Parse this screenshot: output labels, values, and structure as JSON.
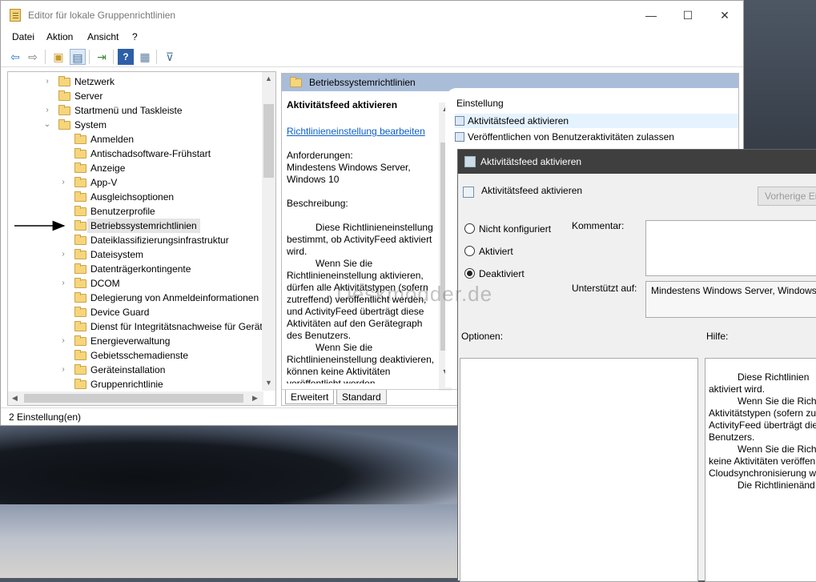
{
  "window": {
    "title": "Editor für lokale Gruppenrichtlinien",
    "minimize": "—",
    "maximize": "☐",
    "close": "✕"
  },
  "menu": [
    "Datei",
    "Aktion",
    "Ansicht",
    "?"
  ],
  "toolbar": {
    "back": "⇦",
    "forward": "⇨",
    "up": "▣",
    "show_hide": "▤",
    "export": "⇥",
    "help": "?",
    "properties": "▦",
    "filter": "⊽"
  },
  "tree": {
    "items": [
      {
        "label": "Netzwerk",
        "expander": "›"
      },
      {
        "label": "Server",
        "expander": ""
      },
      {
        "label": "Startmenü und Taskleiste",
        "expander": "›"
      },
      {
        "label": "System",
        "expander": "⌄"
      },
      {
        "label": "Anmelden",
        "expander": ""
      },
      {
        "label": "Antischadsoftware-Frühstart",
        "expander": ""
      },
      {
        "label": "Anzeige",
        "expander": ""
      },
      {
        "label": "App-V",
        "expander": "›"
      },
      {
        "label": "Ausgleichsoptionen",
        "expander": ""
      },
      {
        "label": "Benutzerprofile",
        "expander": ""
      },
      {
        "label": "Betriebssystemrichtlinien",
        "expander": ""
      },
      {
        "label": "Dateiklassifizierungsinfrastruktur",
        "expander": ""
      },
      {
        "label": "Dateisystem",
        "expander": "›"
      },
      {
        "label": "Datenträgerkontingente",
        "expander": ""
      },
      {
        "label": "DCOM",
        "expander": "›"
      },
      {
        "label": "Delegierung von Anmeldeinformationen",
        "expander": ""
      },
      {
        "label": "Device Guard",
        "expander": ""
      },
      {
        "label": "Dienst für Integritätsnachweise für Geräte",
        "expander": ""
      },
      {
        "label": "Energieverwaltung",
        "expander": "›"
      },
      {
        "label": "Gebietsschemadienste",
        "expander": ""
      },
      {
        "label": "Geräteinstallation",
        "expander": "›"
      },
      {
        "label": "Gruppenrichtlinie",
        "expander": ""
      }
    ]
  },
  "middle": {
    "header": "Betriebssystemrichtlinien",
    "policy_title": "Aktivitätsfeed aktivieren",
    "edit_link": "Richtlinieneinstellung bearbeiten",
    "requirements_label": "Anforderungen:",
    "requirements_value": "Mindestens Windows Server, Windows 10",
    "description_label": "Beschreibung:",
    "description_1": "Diese Richtlinieneinstellung bestimmt, ob ActivityFeed aktiviert wird.",
    "description_2": "Wenn Sie die Richtlinieneinstellung aktivieren, dürfen alle Aktivitätstypen (sofern zutreffend) veröffentlicht werden, und ActivityFeed überträgt diese Aktivitäten auf den Gerätegraph des Benutzers.",
    "description_3": "Wenn Sie die Richtlinieneinstellung deaktivieren, können keine Aktivitäten veröffentlicht werden,",
    "list_header": "Einstellung",
    "rows": [
      "Aktivitätsfeed aktivieren",
      "Veröffentlichen von Benutzeraktivitäten zulassen"
    ],
    "tabs": [
      "Erweitert",
      "Standard"
    ]
  },
  "status": "2 Einstellung(en)",
  "dialog": {
    "title": "Aktivitätsfeed aktivieren",
    "subtitle": "Aktivitätsfeed aktivieren",
    "prev_button": "Vorherige Einstellung",
    "radio_not_configured": "Nicht konfiguriert",
    "radio_enabled": "Aktiviert",
    "radio_disabled": "Deaktiviert",
    "selected": "Deaktiviert",
    "comment_label": "Kommentar:",
    "supported_label": "Unterstützt auf:",
    "supported_value": "Mindestens Windows Server, Windows",
    "options_label": "Optionen:",
    "help_label": "Hilfe:",
    "help_lines": [
      "Diese Richtlinien",
      "aktiviert wird.",
      "Wenn Sie die Richt",
      "Aktivitätstypen (sofern zu",
      "ActivityFeed überträgt die",
      "Benutzers.",
      "Wenn Sie die Richt",
      "keine Aktivitäten veröffen",
      "Cloudsynchronisierung w",
      "Die Richtlinienänd"
    ]
  },
  "watermark": "Deskmodder.de"
}
